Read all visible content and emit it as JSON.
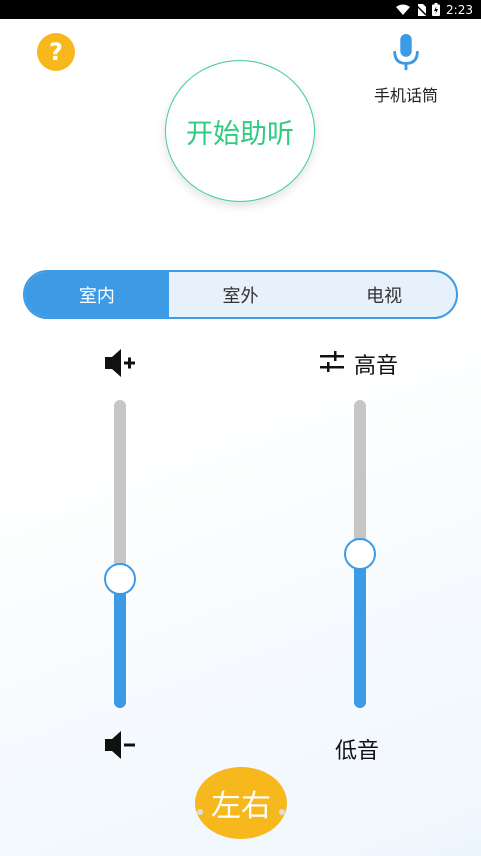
{
  "status": {
    "time": "2:23"
  },
  "help": {
    "glyph": "?"
  },
  "mic": {
    "label": "手机话筒"
  },
  "start": {
    "label": "开始助听"
  },
  "modes": {
    "items": [
      "室内",
      "室外",
      "电视"
    ],
    "active": 0
  },
  "volume": {
    "level": 0.42
  },
  "tone": {
    "high_label": "高音",
    "low_label": "低音",
    "level": 0.5
  },
  "channel": {
    "label": "左右"
  },
  "colors": {
    "accent": "#3d9be6",
    "start_green": "#2fcb7f",
    "yellow": "#f6b81c"
  }
}
